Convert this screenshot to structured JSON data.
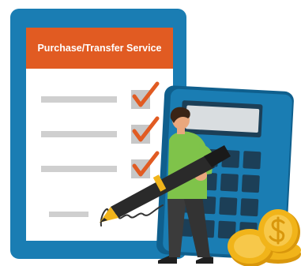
{
  "document": {
    "title": "Purchase/Transfer Service"
  },
  "colors": {
    "clipboard": "#1a7db3",
    "header": "#e15b22",
    "check": "#e15b22",
    "checkbox": "#c7c7c7",
    "calculator": "#1a7db3",
    "shirt": "#7fc34a",
    "coins": "#f1b41a"
  },
  "icons": {
    "clipboard": "clipboard-icon",
    "check": "check-icon",
    "calculator": "calculator-icon",
    "pen": "pen-icon",
    "coin": "coin-icon",
    "signature": "signature-icon"
  }
}
